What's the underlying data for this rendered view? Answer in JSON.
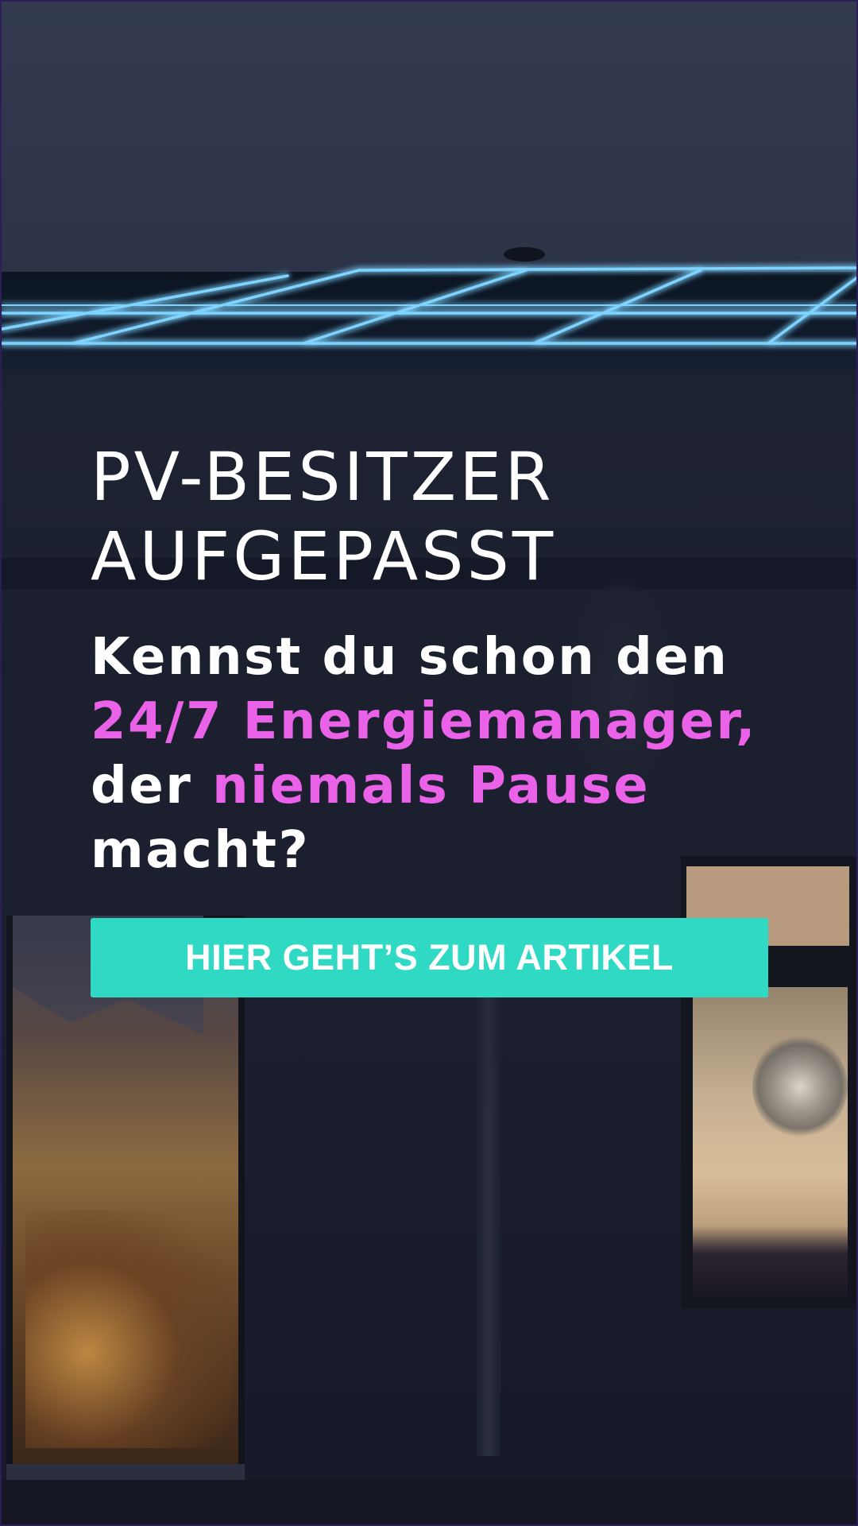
{
  "headline": {
    "line1": "PV-BESITZER",
    "line2": "AUFGEPASST"
  },
  "subheadline": {
    "part1": "Kennst du schon den",
    "part2_highlight": "24/7 Energiemanager,",
    "part3": "der",
    "part4_highlight": "niemals Pause",
    "part5": "macht?"
  },
  "cta": {
    "label": "HIER GEHT’S ZUM ARTIKEL"
  },
  "colors": {
    "highlight": "#ea62e8",
    "cta_background": "#2fd9c3",
    "text": "#ffffff",
    "solar_glow": "#5fc4ff"
  }
}
